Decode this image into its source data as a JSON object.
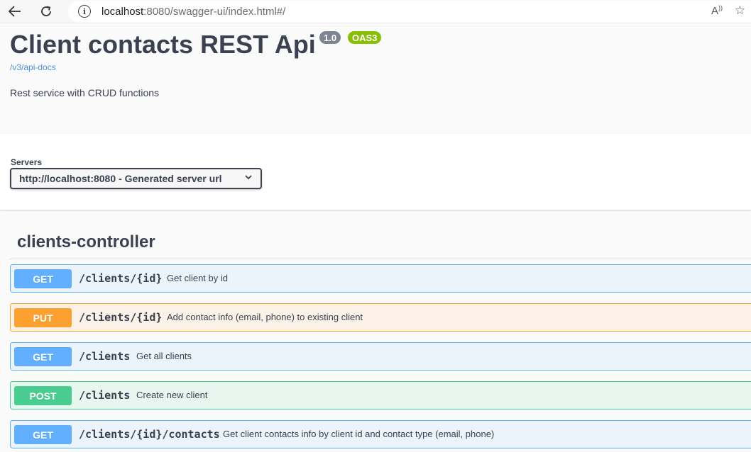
{
  "browser": {
    "url_host": "localhost",
    "url_rest": ":8080/swagger-ui/index.html#/"
  },
  "info": {
    "title": "Client contacts REST Api",
    "version": "1.0",
    "oas": "OAS3",
    "docs_link": "/v3/api-docs",
    "description": "Rest service with CRUD functions"
  },
  "servers": {
    "label": "Servers",
    "selected": "http://localhost:8080 - Generated server url"
  },
  "tag": {
    "title": "clients-controller"
  },
  "operations": [
    {
      "method": "GET",
      "path": "/clients/{id}",
      "summary": "Get client by id"
    },
    {
      "method": "PUT",
      "path": "/clients/{id}",
      "summary": "Add contact info (email, phone) to existing client"
    },
    {
      "method": "GET",
      "path": "/clients",
      "summary": "Get all clients"
    },
    {
      "method": "POST",
      "path": "/clients",
      "summary": "Create new client"
    },
    {
      "method": "GET",
      "path": "/clients/{id}/contacts",
      "summary": "Get client contacts info by client id and contact type (email, phone)"
    }
  ],
  "colors": {
    "get": "#61affe",
    "put": "#fca130",
    "post": "#49cc90",
    "version_badge": "#7d8492",
    "oas_badge": "#89bf04"
  }
}
